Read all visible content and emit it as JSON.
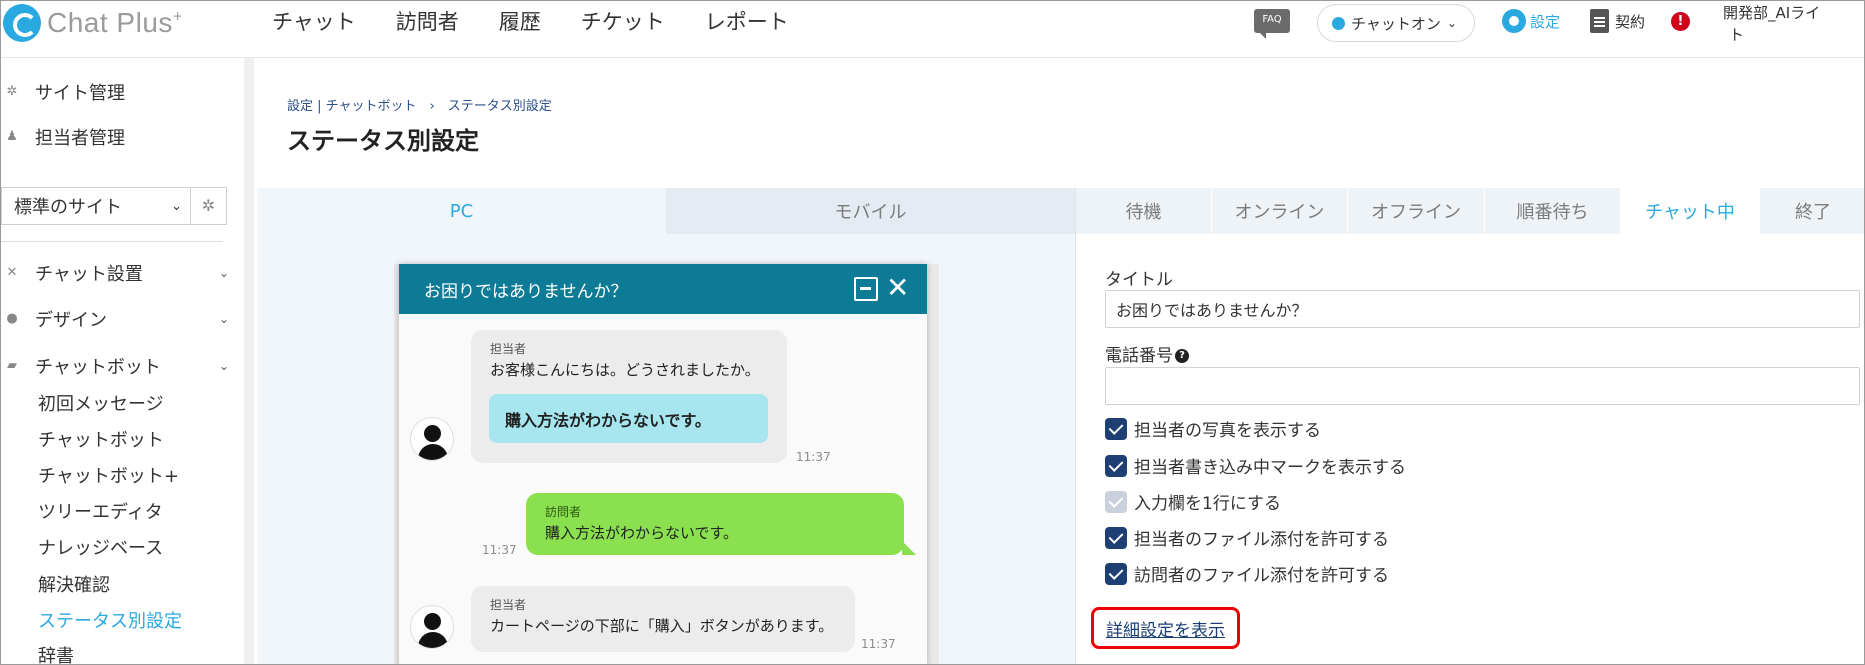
{
  "app": {
    "logo": "Chat Plus",
    "logo_sup": "+"
  },
  "nav": [
    "チャット",
    "訪問者",
    "履歴",
    "チケット",
    "レポート"
  ],
  "header": {
    "faq": "FAQ",
    "chat_status": "チャットオン",
    "settings": "設定",
    "contract": "契約",
    "alert": "!",
    "user_line1": "開発部_AIライ",
    "user_line2": "ト"
  },
  "sidebar": {
    "site_manage": "サイト管理",
    "staff_manage": "担当者管理",
    "site_select": "標準のサイト",
    "chat_setup": "チャット設置",
    "design": "デザイン",
    "chatbot": "チャットボット",
    "sub": [
      "初回メッセージ",
      "チャットボット",
      "チャットボット+",
      "ツリーエディタ",
      "ナレッジベース",
      "解決確認",
      "ステータス別設定",
      "辞書"
    ]
  },
  "breadcrumb": "設定 | チャットボット　›　ステータス別設定",
  "page_title": "ステータス別設定",
  "device_tabs": [
    "PC",
    "モバイル"
  ],
  "status_tabs": [
    "待機",
    "オンライン",
    "オフライン",
    "順番待ち",
    "チャット中",
    "終了"
  ],
  "widget": {
    "title": "お困りではありませんか？",
    "op_label": "担当者",
    "vis_label": "訪問者",
    "msg1": "お客様こんにちは。どうされましたか。",
    "quick_reply": "購入方法がわからないです。",
    "msg2": "購入方法がわからないです。",
    "msg3": "カートページの下部に「購入」ボタンがあります。",
    "time": "11:37"
  },
  "settings": {
    "title_label": "タイトル",
    "title_value": "お困りではありませんか？",
    "phone_label": "電話番号",
    "phone_value": "",
    "checks": [
      "担当者の写真を表示する",
      "担当者書き込み中マークを表示する",
      "入力欄を1行にする",
      "担当者のファイル添付を許可する",
      "訪問者のファイル添付を許可する"
    ],
    "detail_link": "詳細設定を表示"
  }
}
